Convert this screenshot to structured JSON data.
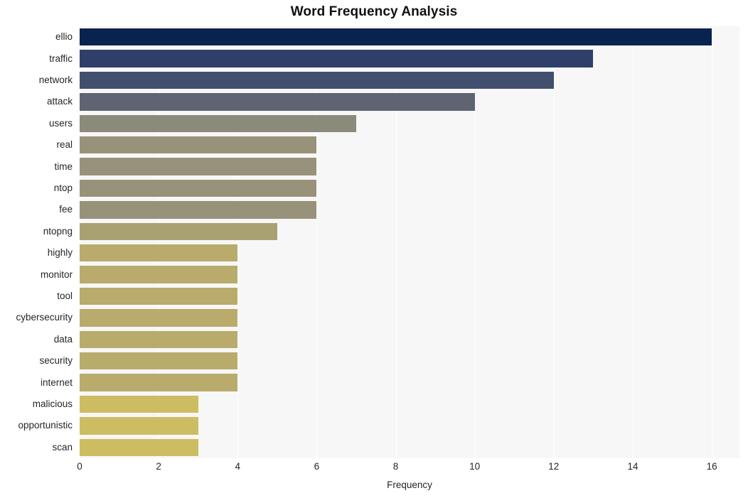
{
  "chart_data": {
    "type": "bar",
    "orientation": "horizontal",
    "title": "Word Frequency Analysis",
    "xlabel": "Frequency",
    "ylabel": "",
    "categories": [
      "ellio",
      "traffic",
      "network",
      "attack",
      "users",
      "real",
      "time",
      "ntop",
      "fee",
      "ntopng",
      "highly",
      "monitor",
      "tool",
      "cybersecurity",
      "data",
      "security",
      "internet",
      "malicious",
      "opportunistic",
      "scan"
    ],
    "values": [
      16,
      13,
      12,
      10,
      7,
      6,
      6,
      6,
      6,
      5,
      4,
      4,
      4,
      4,
      4,
      4,
      4,
      3,
      3,
      3
    ],
    "bar_colors": [
      "#08234f",
      "#2f3f69",
      "#434f6e",
      "#5e6472",
      "#8c8a7b",
      "#98927a",
      "#98927a",
      "#98927a",
      "#98927a",
      "#aaa172",
      "#b8ab6c",
      "#b8ab6c",
      "#b8ab6c",
      "#b8ab6c",
      "#b8ab6c",
      "#b8ab6c",
      "#b8ab6c",
      "#cdbd62",
      "#cdbd62",
      "#cdbd62"
    ],
    "xticks": [
      0,
      2,
      4,
      6,
      8,
      10,
      12,
      14,
      16
    ],
    "xtick_labels": [
      "0",
      "2",
      "4",
      "6",
      "8",
      "10",
      "12",
      "14",
      "16"
    ],
    "xlim": [
      0,
      16.7
    ],
    "grid": true,
    "grid_axis": "x",
    "grid_color": "#ffffff",
    "plot_background": "#f7f7f7",
    "figure_background": "#ffffff",
    "legend": null
  }
}
